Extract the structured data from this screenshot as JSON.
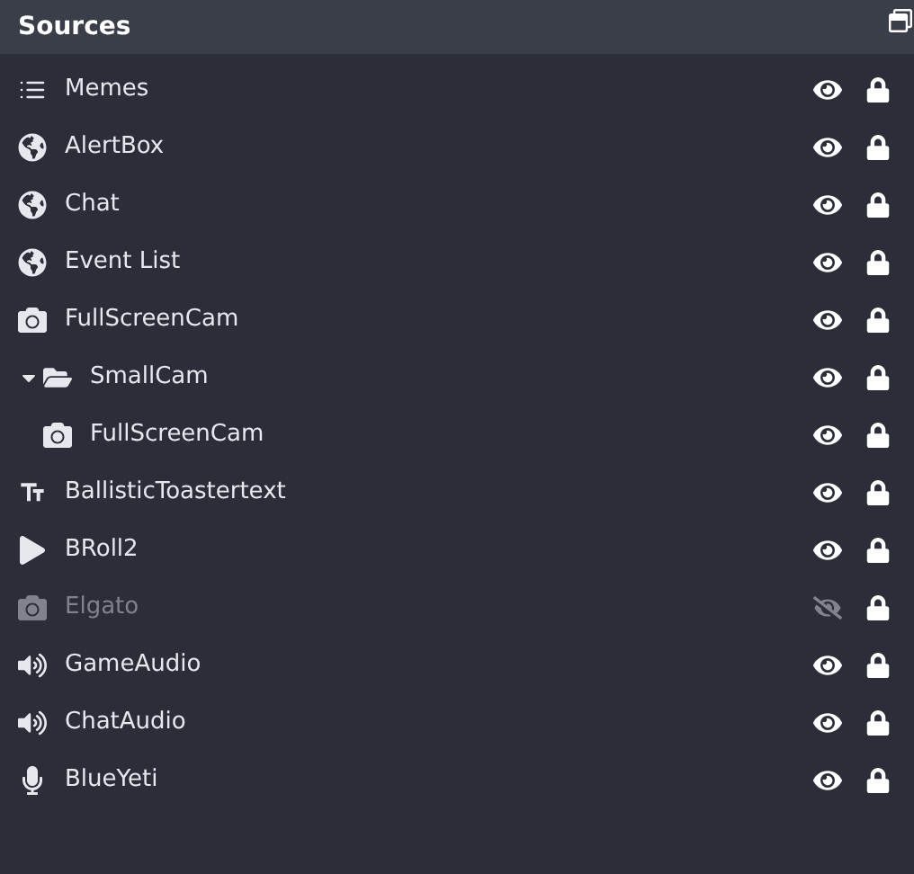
{
  "panel": {
    "title": "Sources"
  },
  "sources": [
    {
      "name": "Memes",
      "kind": "list",
      "visible": true,
      "locked": true
    },
    {
      "name": "AlertBox",
      "kind": "browser",
      "visible": true,
      "locked": true
    },
    {
      "name": "Chat",
      "kind": "browser",
      "visible": true,
      "locked": true
    },
    {
      "name": "Event List",
      "kind": "browser",
      "visible": true,
      "locked": true
    },
    {
      "name": "FullScreenCam",
      "kind": "camera",
      "visible": true,
      "locked": true
    },
    {
      "name": "SmallCam",
      "kind": "folder",
      "expanded": true,
      "visible": true,
      "locked": true,
      "children": [
        {
          "name": "FullScreenCam",
          "kind": "camera",
          "visible": true,
          "locked": true
        }
      ]
    },
    {
      "name": "BallisticToastertext",
      "kind": "text",
      "visible": true,
      "locked": true
    },
    {
      "name": "BRoll2",
      "kind": "media",
      "visible": true,
      "locked": true
    },
    {
      "name": "Elgato",
      "kind": "camera",
      "visible": false,
      "locked": true
    },
    {
      "name": "GameAudio",
      "kind": "audio",
      "visible": true,
      "locked": true
    },
    {
      "name": "ChatAudio",
      "kind": "audio",
      "visible": true,
      "locked": true
    },
    {
      "name": "BlueYeti",
      "kind": "mic",
      "visible": true,
      "locked": true
    }
  ]
}
